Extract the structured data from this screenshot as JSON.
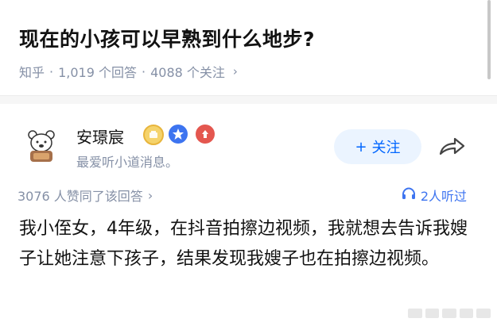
{
  "question": {
    "title": "现在的小孩可以早熟到什么地步?",
    "source": "知乎",
    "separator": "·",
    "answers_count": "1,019 个回答",
    "followers_count": "4088 个关注",
    "chevron": "›"
  },
  "answer": {
    "author_name": "安璟宸",
    "author_bio": "最爱听小道消息。",
    "follow_label": "关注",
    "follow_icon": "+",
    "endorse_text": "3076 人赞同了该回答",
    "endorse_chevron": "›",
    "listeners_text": "2人听过",
    "body": "我小侄女，4年级，在抖音拍擦边视频，我就想去告诉我嫂子让她注意下孩子，结果发现我嫂子也在拍擦边视频。"
  },
  "icons": {
    "avatar": "bear-avatar-icon",
    "badge_1": "gold-badge-icon",
    "badge_2": "blue-star-badge-icon",
    "badge_3": "red-badge-icon",
    "share": "share-icon",
    "headphones": "headphones-icon"
  },
  "colors": {
    "accent": "#0066ff",
    "muted": "#8590a6",
    "follow_bg": "#ebf4ff",
    "text": "#121212"
  }
}
